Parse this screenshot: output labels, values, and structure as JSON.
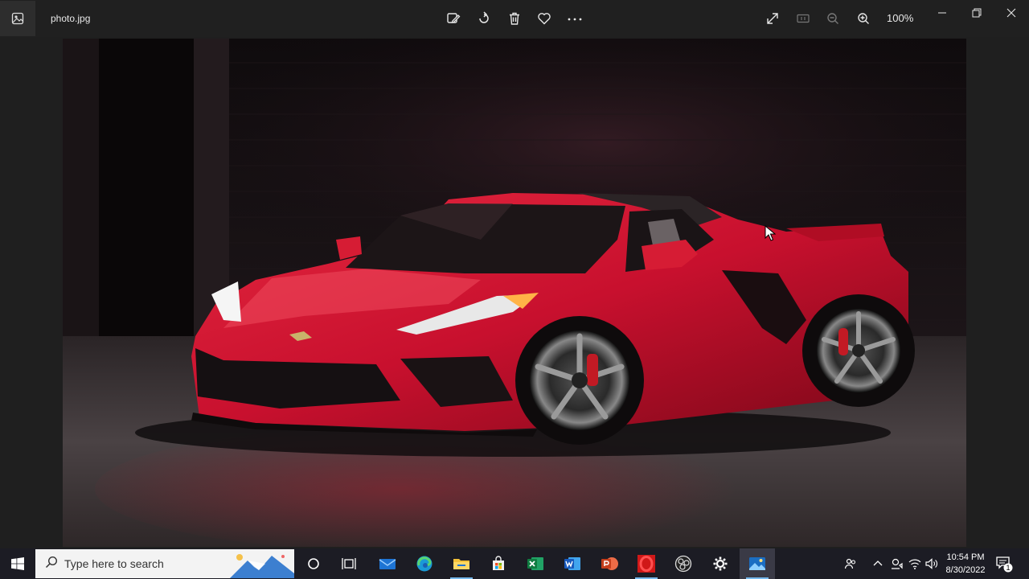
{
  "window": {
    "file_name": "photo.jpg",
    "zoom": "100%",
    "toolbar_icons": [
      "edit-image-icon",
      "rotate-icon",
      "delete-icon",
      "favorite-icon",
      "more-icon"
    ],
    "view_icons": [
      "fullscreen-icon",
      "actual-size-icon",
      "zoom-out-icon",
      "zoom-in-icon"
    ],
    "window_controls": [
      "minimize-icon",
      "restore-icon",
      "close-icon"
    ]
  },
  "photo": {
    "subject": "red sports car",
    "colors": {
      "car": "#c8102e",
      "background": "#120d10",
      "floor": "#3a3434"
    }
  },
  "taskbar": {
    "search_placeholder": "Type here to search",
    "apps": [
      "cortana-icon",
      "task-view-icon",
      "mail-icon",
      "edge-icon",
      "file-explorer-icon",
      "store-icon",
      "excel-icon",
      "word-icon",
      "powerpoint-icon",
      "opera-icon",
      "obs-icon",
      "settings-icon",
      "photos-icon"
    ],
    "tray": [
      "people-icon",
      "chevron-up-icon",
      "meet-now-icon",
      "network-icon",
      "volume-icon"
    ],
    "time": "10:54 PM",
    "date": "8/30/2022",
    "notification_count": "1"
  }
}
